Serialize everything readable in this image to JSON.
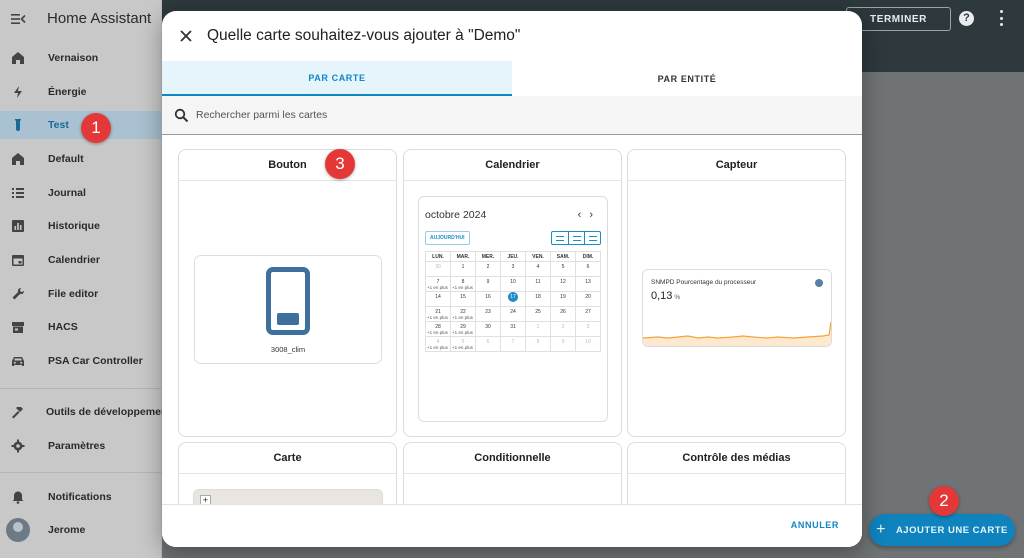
{
  "app": {
    "title": "Home Assistant"
  },
  "sidebar": {
    "items": [
      {
        "label": "Vernaison",
        "icon": "home-icon"
      },
      {
        "label": "Énergie",
        "icon": "lightning-icon"
      },
      {
        "label": "Test",
        "icon": "test-tube-icon",
        "active": true
      },
      {
        "label": "Default",
        "icon": "home-icon"
      },
      {
        "label": "Journal",
        "icon": "list-icon"
      },
      {
        "label": "Historique",
        "icon": "chart-box-icon"
      },
      {
        "label": "Calendrier",
        "icon": "calendar-icon"
      },
      {
        "label": "File editor",
        "icon": "wrench-icon"
      },
      {
        "label": "HACS",
        "icon": "store-icon"
      },
      {
        "label": "PSA Car Controller",
        "icon": "car-icon"
      }
    ],
    "bottom": [
      {
        "label": "Outils de développement",
        "icon": "hammer-icon"
      },
      {
        "label": "Paramètres",
        "icon": "gear-icon"
      },
      {
        "label": "Notifications",
        "icon": "bell-icon"
      },
      {
        "label": "Jerome",
        "icon": "avatar"
      }
    ]
  },
  "topbar": {
    "done_label": "TERMINER",
    "help_glyph": "?"
  },
  "fab": {
    "plus": "+",
    "label": "AJOUTER UNE CARTE"
  },
  "badges": [
    "1",
    "2",
    "3"
  ],
  "dialog": {
    "title": "Quelle carte souhaitez-vous ajouter à \"Demo\"",
    "tabs": [
      {
        "label": "PAR CARTE",
        "active": true
      },
      {
        "label": "PAR ENTITÉ",
        "active": false
      }
    ],
    "search_placeholder": "Rechercher parmi les cartes",
    "cancel_label": "ANNULER",
    "cards": {
      "button": {
        "title": "Bouton",
        "entity_name": "3008_clim"
      },
      "calendar": {
        "title": "Calendrier",
        "month": "octobre 2024",
        "prev": "‹",
        "next": "›",
        "today_label": "AUJOURD'HUI",
        "weekdays": [
          "LUN.",
          "MAR.",
          "MER.",
          "JEU.",
          "VEN.",
          "SAM.",
          "DIM."
        ],
        "weeks": [
          [
            {
              "d": "30",
              "m": true
            },
            {
              "d": "1"
            },
            {
              "d": "2"
            },
            {
              "d": "3"
            },
            {
              "d": "4"
            },
            {
              "d": "5"
            },
            {
              "d": "6"
            }
          ],
          [
            {
              "d": "7",
              "more": "+1 en plus"
            },
            {
              "d": "8",
              "more": "+1 en plus"
            },
            {
              "d": "9"
            },
            {
              "d": "10"
            },
            {
              "d": "11"
            },
            {
              "d": "12"
            },
            {
              "d": "13"
            }
          ],
          [
            {
              "d": "14"
            },
            {
              "d": "15"
            },
            {
              "d": "16"
            },
            {
              "d": "17",
              "today": true
            },
            {
              "d": "18"
            },
            {
              "d": "19"
            },
            {
              "d": "20"
            }
          ],
          [
            {
              "d": "21",
              "more": "+1 en plus"
            },
            {
              "d": "22",
              "more": "+1 en plus"
            },
            {
              "d": "23"
            },
            {
              "d": "24"
            },
            {
              "d": "25"
            },
            {
              "d": "26"
            },
            {
              "d": "27"
            }
          ],
          [
            {
              "d": "28",
              "more": "+1 en plus"
            },
            {
              "d": "29",
              "more": "+1 en plus"
            },
            {
              "d": "30"
            },
            {
              "d": "31"
            },
            {
              "d": "1",
              "m": true
            },
            {
              "d": "2",
              "m": true
            },
            {
              "d": "3",
              "m": true
            }
          ],
          [
            {
              "d": "4",
              "m": true,
              "more": "+1 en plus"
            },
            {
              "d": "5",
              "m": true,
              "more": "+1 en plus"
            },
            {
              "d": "6",
              "m": true
            },
            {
              "d": "7",
              "m": true
            },
            {
              "d": "8",
              "m": true
            },
            {
              "d": "9",
              "m": true
            },
            {
              "d": "10",
              "m": true
            }
          ]
        ]
      },
      "sensor": {
        "title": "Capteur",
        "name": "SNMPD Pourcentage du processeur",
        "value": "0,13",
        "unit": "%"
      },
      "map": {
        "title": "Carte",
        "zoom_in": "+"
      },
      "conditional": {
        "title": "Conditionnelle"
      },
      "media": {
        "title": "Contrôle des médias"
      }
    }
  },
  "colors": {
    "accent": "#0f87c4",
    "topbar": "#2d393d",
    "badge": "#e43838",
    "sensor_line": "#f5a33b"
  }
}
